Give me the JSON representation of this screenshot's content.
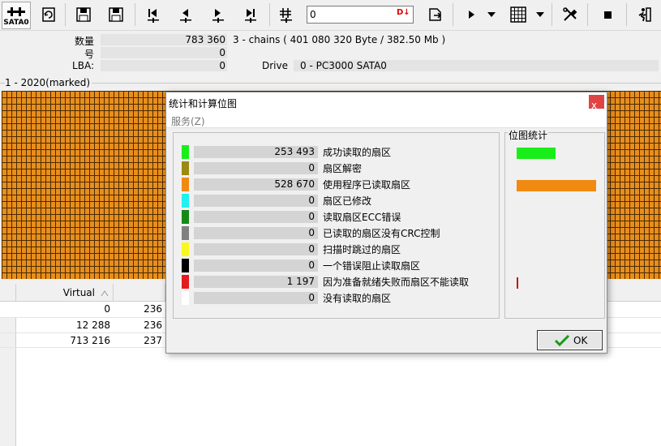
{
  "toolbar": {
    "device_button_label": "SATA0",
    "lba_input_value": "0",
    "input_badge": "D↓"
  },
  "info": {
    "count_label": "数量",
    "count_value": "783 360",
    "chains_text": "3 - chains  (  401 080 320 Byte  /  382.50 Mb )",
    "number_label": "号",
    "number_value": "0",
    "lba_label": "LBA:",
    "lba_value": "0",
    "drive_label": "Drive",
    "drive_value": "0 - PC3000 SATA0"
  },
  "group": {
    "label": "1 - 2020(marked)"
  },
  "table": {
    "header_virtual": "Virtual",
    "rows": [
      {
        "virtual": "0",
        "next": "236"
      },
      {
        "virtual": "12 288",
        "next": "236"
      },
      {
        "virtual": "713 216",
        "next": "237"
      }
    ]
  },
  "dialog": {
    "title": "统计和计算位图",
    "close_glyph": "x",
    "menu_service": "服务(Z)",
    "bitmap_legend": "位图统计",
    "ok_label": "OK",
    "stats": [
      {
        "color": "#1aee1a",
        "value": "253 493",
        "label": "成功读取的扇区"
      },
      {
        "color": "#9a8a10",
        "value": "0",
        "label": "扇区解密"
      },
      {
        "color": "#f08a10",
        "value": "528 670",
        "label": "使用程序已读取扇区"
      },
      {
        "color": "#20f0f0",
        "value": "0",
        "label": "扇区已修改"
      },
      {
        "color": "#168a16",
        "value": "0",
        "label": "读取扇区ECC错误"
      },
      {
        "color": "#808080",
        "value": "0",
        "label": "已读取的扇区没有CRC控制"
      },
      {
        "color": "#f8f820",
        "value": "0",
        "label": "扫描时跳过的扇区"
      },
      {
        "color": "#000000",
        "value": "0",
        "label": "一个错误阻止读取扇区"
      },
      {
        "color": "#e41c1c",
        "value": "1 197",
        "label": "因为准备就绪失败而扇区不能读取"
      },
      {
        "color": "#ffffff",
        "value": "0",
        "label": "没有读取的扇区"
      }
    ]
  }
}
